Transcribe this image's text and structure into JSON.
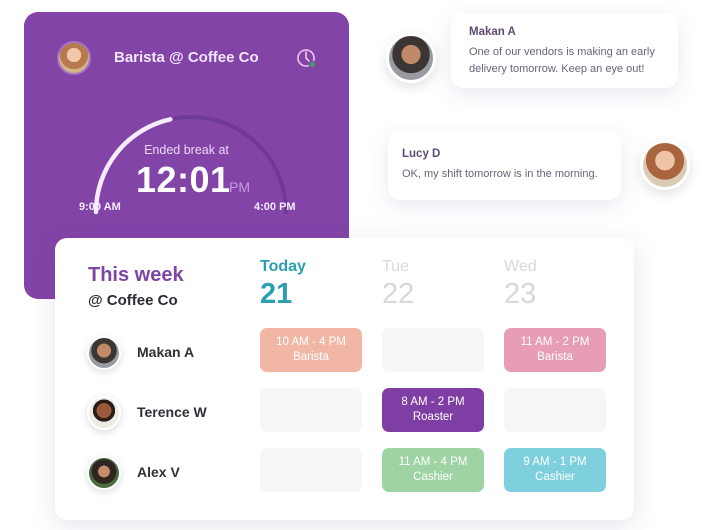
{
  "shift_card": {
    "title": "Barista @ Coffee Co",
    "icon": "clock-status-icon",
    "status_label": "Ended break at",
    "time": "12:01",
    "ampm": "PM",
    "start_label": "9:00 AM",
    "end_label": "4:00 PM",
    "progress_fraction": 0.43,
    "colors": {
      "card": "#8344a8",
      "arc_filled": "#f6ecfc",
      "arc_track": "#6f3a96"
    }
  },
  "messages": [
    {
      "name": "Makan A",
      "text_line1": "One of our vendors is making an early",
      "text_line2": "delivery tomorrow. Keep an eye out!"
    },
    {
      "name": "Lucy D",
      "text_line1": "OK, my shift tomorrow is in the morning.",
      "text_line2": ""
    }
  ],
  "schedule": {
    "title": "This week",
    "subtitle": "@ Coffee Co",
    "days": [
      {
        "name": "Today",
        "number": "21"
      },
      {
        "name": "Tue",
        "number": "22"
      },
      {
        "name": "Wed",
        "number": "23"
      }
    ],
    "employees": [
      {
        "name": "Makan A",
        "shifts": [
          {
            "time": "10 AM - 4 PM",
            "role": "Barista",
            "color": "#f1b6a4"
          },
          null,
          {
            "time": "11 AM - 2 PM",
            "role": "Barista",
            "color": "#e79db3"
          }
        ]
      },
      {
        "name": "Terence W",
        "shifts": [
          null,
          {
            "time": "8 AM - 2 PM",
            "role": "Roaster",
            "color": "#7f3ea3"
          },
          null
        ]
      },
      {
        "name": "Alex V",
        "shifts": [
          null,
          {
            "time": "11 AM - 4 PM",
            "role": "Cashier",
            "color": "#9ed3a4"
          },
          {
            "time": "9 AM - 1 PM",
            "role": "Cashier",
            "color": "#7fd0df"
          }
        ]
      }
    ]
  }
}
